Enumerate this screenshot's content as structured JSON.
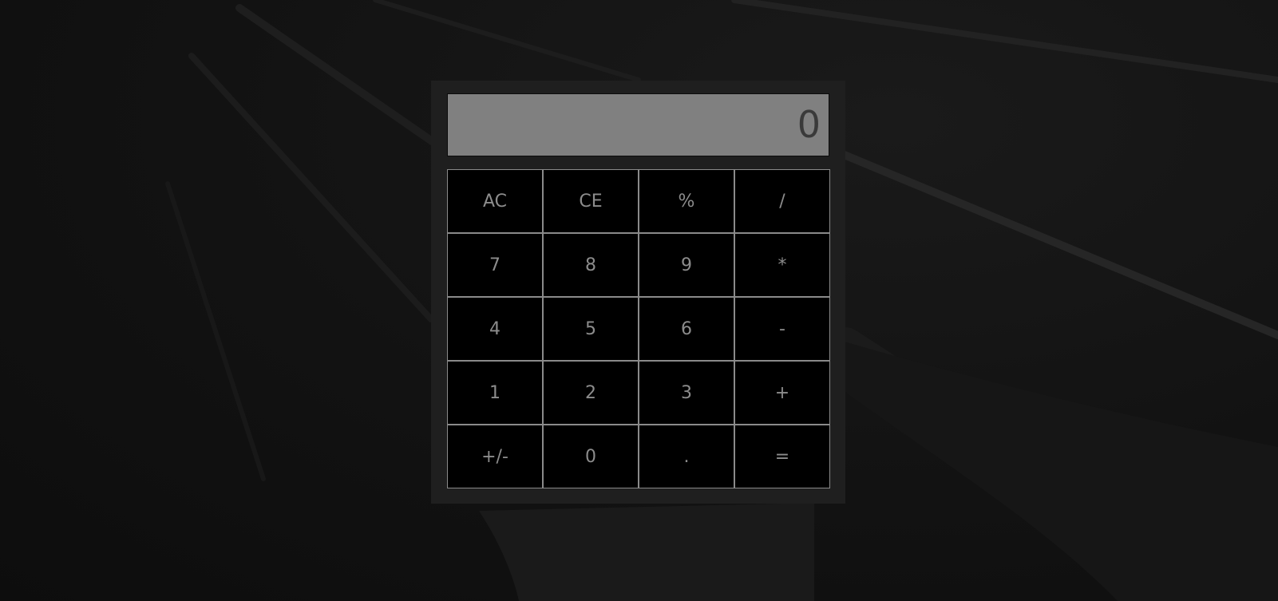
{
  "calculator": {
    "display_value": "0",
    "keys": [
      "AC",
      "CE",
      "%",
      "/",
      "7",
      "8",
      "9",
      "*",
      "4",
      "5",
      "6",
      "-",
      "1",
      "2",
      "3",
      "+",
      "+/-",
      "0",
      ".",
      "="
    ]
  },
  "colors": {
    "background": "#111111",
    "panel": "#1f1f1f",
    "display": "#808080",
    "display_text": "#3a3a3a",
    "key_bg": "#000000",
    "key_border": "#8a8a8a",
    "key_text": "#8c8c8c"
  }
}
